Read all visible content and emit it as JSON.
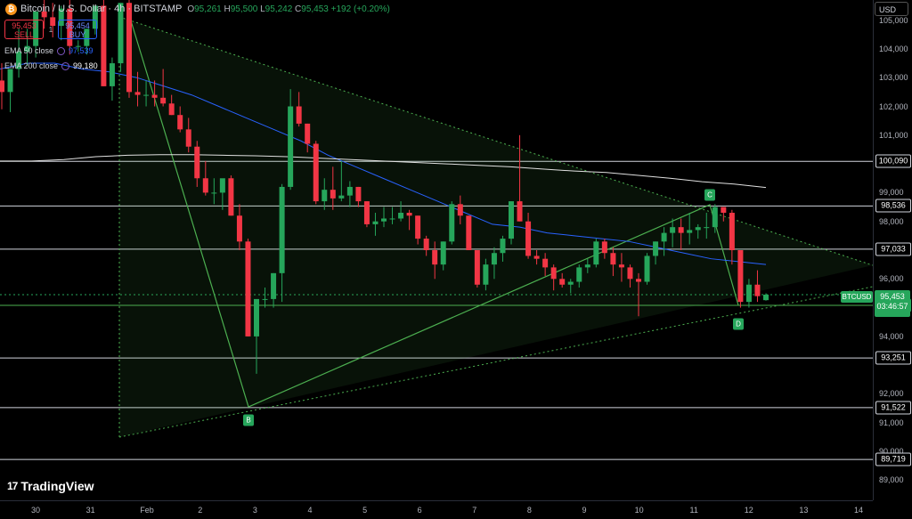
{
  "header": {
    "logo_glyph": "₿",
    "symbol_title": "Bitcoin / U.S. Dollar · 4h · BITSTAMP",
    "ohlc": [
      {
        "key": "O",
        "value": "95,261"
      },
      {
        "key": "H",
        "value": "95,500"
      },
      {
        "key": "L",
        "value": "95,242"
      },
      {
        "key": "C",
        "value": "95,453"
      }
    ],
    "change": "+192 (+0.20%)"
  },
  "trade": {
    "sell_price": "95,453",
    "sell_label": "SELL",
    "spread": "1",
    "buy_price": "95,454",
    "buy_label": "BUY"
  },
  "indicators": [
    {
      "name": "EMA 50 close",
      "value": "97,539",
      "color": "#2962ff"
    },
    {
      "name": "EMA 200 close",
      "value": "99,180",
      "color": "#e0e0e0"
    }
  ],
  "currency": "USD",
  "last_price": {
    "symbol": "BTCUSD",
    "price": "95,453",
    "countdown": "03:46:57"
  },
  "branding": {
    "logo_mark": "17",
    "name": "TradingView"
  },
  "colors": {
    "up": "#26a65b",
    "down": "#f23645",
    "ema50": "#2962ff",
    "ema200": "#e0e0e0",
    "pattern": "#4caf50"
  },
  "chart_data": {
    "type": "candlestick",
    "x_tick_labels": [
      "30",
      "31",
      "Feb",
      "2",
      "3",
      "4",
      "5",
      "6",
      "7",
      "8",
      "9",
      "10",
      "11",
      "12",
      "13",
      "14"
    ],
    "y_tick_labels": [
      "105,000",
      "104,000",
      "103,000",
      "102,000",
      "101,000",
      "99,000",
      "98,000",
      "96,000",
      "94,000",
      "92,000",
      "91,000",
      "90,000",
      "89,000"
    ],
    "ylim": [
      88300,
      105700
    ],
    "horizontal_levels": [
      {
        "value": 100090,
        "label": "100,090"
      },
      {
        "value": 98536,
        "label": "98,536"
      },
      {
        "value": 97033,
        "label": "97,033"
      },
      {
        "value": 95080,
        "label": "95,080",
        "highlight": true
      },
      {
        "value": 93251,
        "label": "93,251"
      },
      {
        "value": 91522,
        "label": "91,522"
      },
      {
        "value": 89719,
        "label": "89,719"
      }
    ],
    "pattern_points": [
      {
        "label": "B",
        "date": "Feb 2",
        "value": 91550
      },
      {
        "label": "C",
        "date": "Feb 11",
        "value": 98580
      },
      {
        "label": "D",
        "date": "Feb 11",
        "value": 95080
      }
    ],
    "candles_ohlc": [
      [
        102900,
        103500,
        101900,
        102500
      ],
      [
        102500,
        103300,
        101800,
        103300
      ],
      [
        103300,
        104700,
        103000,
        103900
      ],
      [
        103900,
        104700,
        103400,
        104100
      ],
      [
        104100,
        105300,
        103700,
        105300
      ],
      [
        105300,
        106000,
        104700,
        105100
      ],
      [
        105100,
        105600,
        104400,
        104800
      ],
      [
        104800,
        105500,
        104300,
        105400
      ],
      [
        105400,
        105800,
        103800,
        104100
      ],
      [
        104100,
        104300,
        103900,
        104100
      ],
      [
        104100,
        104700,
        103800,
        104700
      ],
      [
        104700,
        105500,
        104500,
        105500
      ],
      [
        105500,
        105700,
        102700,
        102700
      ],
      [
        102700,
        103700,
        102200,
        103500
      ],
      [
        103500,
        105600,
        103200,
        105600
      ],
      [
        105600,
        105700,
        102300,
        102500
      ],
      [
        102500,
        103200,
        102000,
        102400
      ],
      [
        102400,
        102900,
        102000,
        102400
      ],
      [
        102400,
        102900,
        102000,
        102300
      ],
      [
        102300,
        103300,
        102000,
        102100
      ],
      [
        102100,
        102400,
        101700,
        101700
      ],
      [
        101700,
        102000,
        101100,
        101200
      ],
      [
        101200,
        101600,
        100400,
        100600
      ],
      [
        100600,
        100800,
        99200,
        99500
      ],
      [
        99500,
        100100,
        98900,
        99000
      ],
      [
        99000,
        99500,
        98600,
        99000
      ],
      [
        99000,
        99400,
        98400,
        99500
      ],
      [
        99500,
        99600,
        98200,
        98200
      ],
      [
        98200,
        98600,
        97000,
        97300
      ],
      [
        97300,
        97400,
        94000,
        94000
      ],
      [
        94000,
        95000,
        92700,
        95300
      ],
      [
        95300,
        95700,
        95000,
        95300
      ],
      [
        95300,
        96200,
        95000,
        96200
      ],
      [
        96200,
        99300,
        95200,
        99200
      ],
      [
        99200,
        102600,
        99100,
        102000
      ],
      [
        102000,
        102500,
        101300,
        101400
      ],
      [
        101400,
        101400,
        100400,
        100700
      ],
      [
        100700,
        100800,
        98600,
        98700
      ],
      [
        98700,
        99500,
        98400,
        99100
      ],
      [
        99100,
        99900,
        98400,
        98800
      ],
      [
        98800,
        100100,
        98700,
        98900
      ],
      [
        98900,
        99400,
        98500,
        99200
      ],
      [
        99200,
        99200,
        98500,
        98700
      ],
      [
        98700,
        98700,
        97800,
        97900
      ],
      [
        97900,
        98300,
        97500,
        98000
      ],
      [
        98000,
        98500,
        97800,
        98100
      ],
      [
        98100,
        98500,
        97900,
        98100
      ],
      [
        98100,
        98700,
        98000,
        98300
      ],
      [
        98300,
        98400,
        97700,
        98200
      ],
      [
        98200,
        98200,
        97200,
        97400
      ],
      [
        97400,
        97500,
        96800,
        97000
      ],
      [
        97000,
        97300,
        96000,
        96500
      ],
      [
        96500,
        97300,
        96300,
        97300
      ],
      [
        97300,
        98700,
        97200,
        98600
      ],
      [
        98600,
        98900,
        97900,
        98200
      ],
      [
        98200,
        98200,
        97000,
        97000
      ],
      [
        97000,
        97000,
        95700,
        95800
      ],
      [
        95800,
        96700,
        95600,
        96500
      ],
      [
        96500,
        97100,
        96000,
        96900
      ],
      [
        96900,
        97500,
        96600,
        97400
      ],
      [
        97400,
        98700,
        97200,
        98700
      ],
      [
        98700,
        101000,
        98000,
        98000
      ],
      [
        98000,
        98300,
        96700,
        96800
      ],
      [
        96800,
        97000,
        96500,
        96700
      ],
      [
        96700,
        96900,
        96100,
        96400
      ],
      [
        96400,
        96500,
        95600,
        96000
      ],
      [
        96000,
        96200,
        95700,
        95800
      ],
      [
        95800,
        96000,
        95500,
        95900
      ],
      [
        95900,
        96500,
        95700,
        96400
      ],
      [
        96400,
        96700,
        96200,
        96500
      ],
      [
        96500,
        97400,
        96400,
        97300
      ],
      [
        97300,
        97400,
        96700,
        96900
      ],
      [
        96900,
        97100,
        96100,
        96500
      ],
      [
        96500,
        96900,
        95900,
        96400
      ],
      [
        96400,
        96500,
        95700,
        96000
      ],
      [
        96000,
        96200,
        94700,
        95900
      ],
      [
        95900,
        96900,
        95800,
        96800
      ],
      [
        96800,
        97300,
        96500,
        97300
      ],
      [
        97300,
        97800,
        96800,
        97600
      ],
      [
        97600,
        98100,
        97100,
        97800
      ],
      [
        97800,
        98100,
        97000,
        97600
      ],
      [
        97600,
        98300,
        97200,
        97700
      ],
      [
        97700,
        97900,
        97400,
        97800
      ],
      [
        97800,
        98300,
        97400,
        97800
      ],
      [
        97800,
        98600,
        97600,
        98500
      ],
      [
        98500,
        98500,
        98000,
        98300
      ],
      [
        98300,
        98400,
        96500,
        97000
      ],
      [
        97000,
        97000,
        95000,
        95200
      ],
      [
        95200,
        96000,
        95000,
        95800
      ],
      [
        95800,
        96300,
        95200,
        95400
      ],
      [
        95261,
        95500,
        95242,
        95453
      ]
    ],
    "ema50": [
      103300,
      103500,
      103500,
      103300,
      103200,
      103000,
      102700,
      102400,
      102000,
      101600,
      101200,
      100800,
      100300,
      99900,
      99500,
      99100,
      98700,
      98300,
      97900,
      97800,
      97600,
      97500,
      97400,
      97300,
      97100,
      96900,
      96700,
      96600,
      96500
    ],
    "ema200": [
      100100,
      100100,
      100150,
      100250,
      100300,
      100320,
      100320,
      100300,
      100280,
      100250,
      100200,
      100150,
      100100,
      100050,
      100000,
      99950,
      99900,
      99820,
      99750,
      99700,
      99600,
      99500,
      99380,
      99300,
      99180
    ]
  }
}
